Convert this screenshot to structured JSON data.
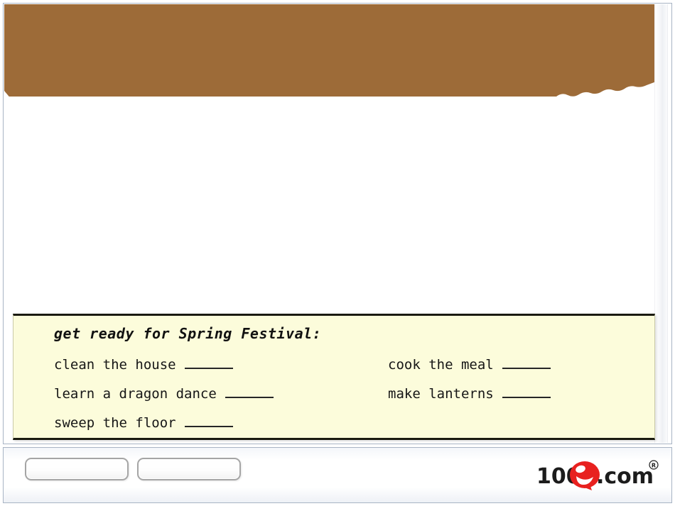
{
  "window": {
    "background_color": "#ffffff",
    "frame_border_color": "#a8b4c4"
  },
  "banner": {
    "name": "brown-banner",
    "color": "#9d6b38",
    "edge_style": "scalloped-wave-bottom"
  },
  "exercise_card": {
    "background_color": "#fcfcdb",
    "border_color": "#1a1a0f",
    "heading": "get ready for Spring Festival:",
    "rows": [
      {
        "left": {
          "label": "clean the house",
          "blank": ""
        },
        "right": {
          "label": "cook the meal",
          "blank": ""
        }
      },
      {
        "left": {
          "label": "learn a dragon dance",
          "blank": ""
        },
        "right": {
          "label": "make lanterns",
          "blank": ""
        }
      },
      {
        "left": {
          "label": "sweep the floor",
          "blank": ""
        },
        "right": null
      }
    ]
  },
  "toolbar": {
    "prev_label": "",
    "next_label": ""
  },
  "logo": {
    "text_part_one": "100",
    "text_part_two": ".com",
    "accent_letter": "e",
    "trademark": "®",
    "accent_color": "#e8211f",
    "text_color": "#1c1c1c"
  },
  "scrollbar": {
    "name": "vertical-scroll-strip",
    "visible": true
  }
}
